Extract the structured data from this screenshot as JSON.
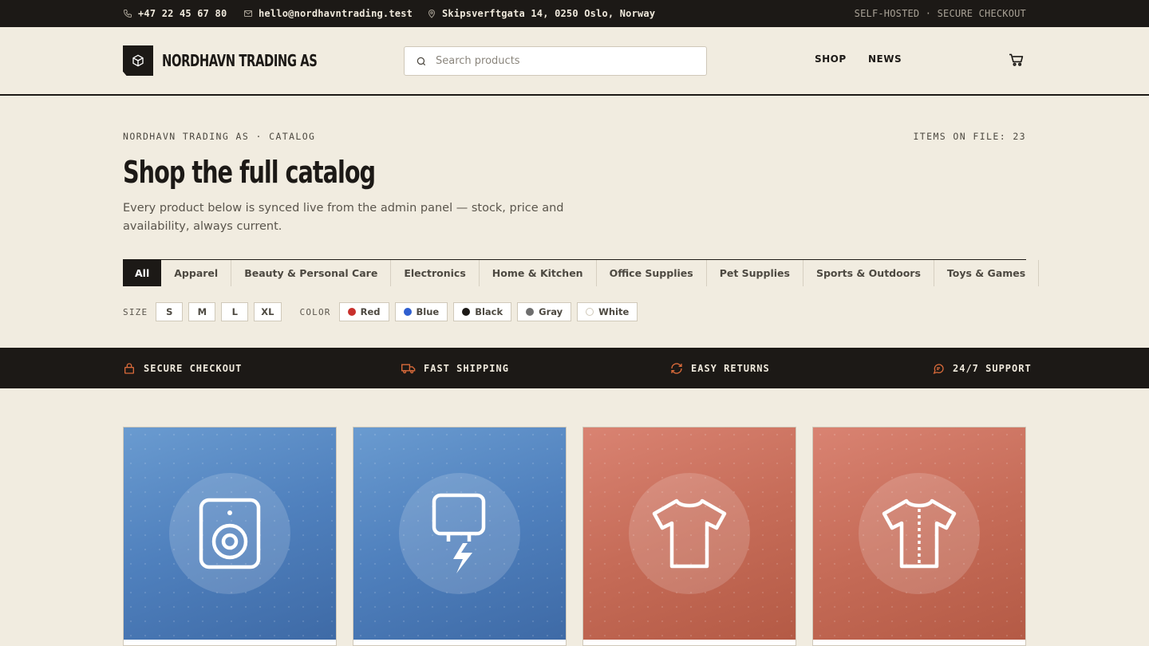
{
  "topbar": {
    "phone": "+47 22 45 67 80",
    "email": "hello@nordhavntrading.test",
    "address": "Skipsverftgata 14, 0250 Oslo, Norway",
    "tagline": "SELF-HOSTED · SECURE CHECKOUT"
  },
  "header": {
    "brand": "NORDHAVN TRADING AS",
    "search_placeholder": "Search products",
    "nav": [
      "SHOP",
      "NEWS"
    ]
  },
  "hero": {
    "eyebrow": "NORDHAVN TRADING AS · CATALOG",
    "items_on_file": "ITEMS ON FILE: 23",
    "title": "Shop the full catalog",
    "lead": "Every product below is synced live from the admin panel — stock, price and availability, always current."
  },
  "categories": [
    "All",
    "Apparel",
    "Beauty & Personal Care",
    "Electronics",
    "Home & Kitchen",
    "Office Supplies",
    "Pet Supplies",
    "Sports & Outdoors",
    "Toys & Games"
  ],
  "active_category": "All",
  "filters": {
    "size_label": "SIZE",
    "sizes": [
      "S",
      "M",
      "L",
      "XL"
    ],
    "color_label": "COLOR",
    "colors": [
      {
        "name": "Red",
        "hex": "#c8302c"
      },
      {
        "name": "Blue",
        "hex": "#2f5fd0"
      },
      {
        "name": "Black",
        "hex": "#1c1916"
      },
      {
        "name": "Gray",
        "hex": "#6e6e6e"
      },
      {
        "name": "White",
        "hex": "#ffffff"
      }
    ]
  },
  "trust": [
    "SECURE CHECKOUT",
    "FAST SHIPPING",
    "EASY RETURNS",
    "24/7 SUPPORT"
  ],
  "accent_color": "#d86a3a",
  "products": [
    {
      "icon": "speaker-icon",
      "tint": "blue"
    },
    {
      "icon": "charger-icon",
      "tint": "blue"
    },
    {
      "icon": "tshirt-icon",
      "tint": "red"
    },
    {
      "icon": "shirt-icon",
      "tint": "red"
    }
  ]
}
